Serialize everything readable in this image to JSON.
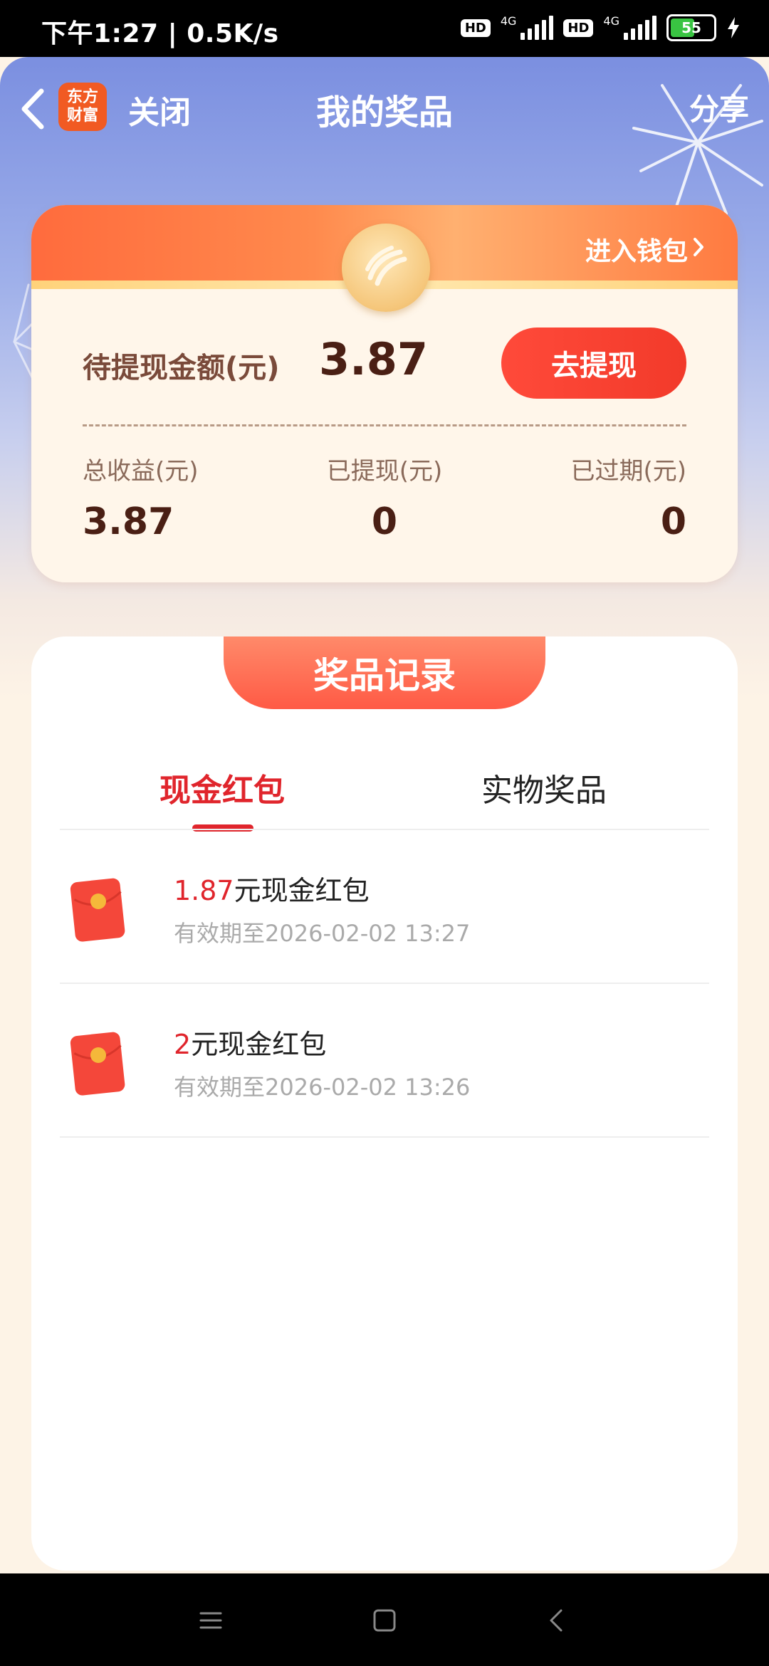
{
  "status_bar": {
    "time_speed": "下午1:27 | 0.5K/s",
    "hd1": "HD",
    "net1": "4G",
    "hd2": "HD",
    "net2": "4G",
    "battery": "55"
  },
  "header": {
    "logo_line1": "东方",
    "logo_line2": "财富",
    "close_label": "关闭",
    "title": "我的奖品",
    "share_label": "分享"
  },
  "balance_card": {
    "wallet_link": "进入钱包",
    "pending_label": "待提现金额(元)",
    "pending_value": "3.87",
    "withdraw_button": "去提现",
    "stats": [
      {
        "label": "总收益(元)",
        "value": "3.87"
      },
      {
        "label": "已提现(元)",
        "value": "0"
      },
      {
        "label": "已过期(元)",
        "value": "0"
      }
    ]
  },
  "records": {
    "heading": "奖品记录",
    "tabs": [
      {
        "label": "现金红包",
        "active": true
      },
      {
        "label": "实物奖品",
        "active": false
      }
    ],
    "items": [
      {
        "amount": "1.87",
        "suffix": "元现金红包",
        "expiry": "有效期至2026-02-02 13:27"
      },
      {
        "amount": "2",
        "suffix": "元现金红包",
        "expiry": "有效期至2026-02-02 13:26"
      }
    ]
  },
  "colors": {
    "accent_red": "#e0252c",
    "button_red": "#f23a2a",
    "header_blue": "#7b8fe0"
  }
}
